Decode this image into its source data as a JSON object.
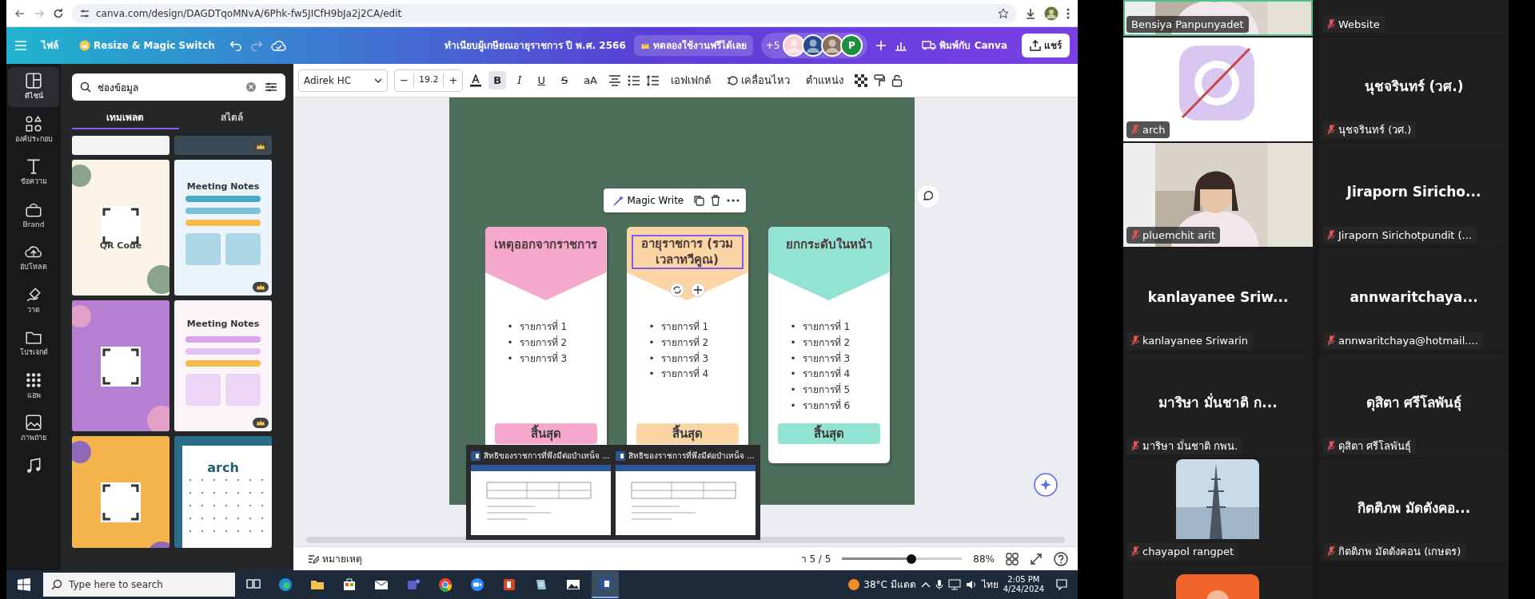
{
  "browser": {
    "url": "canva.com/design/DAGDTqoMNvA/6Phk-fw5JICfH9bJa2j2CA/edit"
  },
  "canva_header": {
    "file_menu": "ไฟล์",
    "resize_button": "Resize & Magic Switch",
    "document_title": "ทำเนียบผู้เกษียณอายุราชการ ปี พ.ศ. 2566",
    "trial_button": "ทดลองใช้งานฟรีได้เลย",
    "collaborators_more": "+5",
    "collaborator_initial": "P",
    "print_button": "พิมพ์กับ Canva",
    "share_button": "แชร์"
  },
  "text_toolbar": {
    "font": "Adirek HC",
    "decrease": "−",
    "font_size": "19.2",
    "increase": "+",
    "format_buttons": [
      {
        "kind": "bold",
        "label": "B",
        "selected": true
      },
      {
        "kind": "italic",
        "label": "I",
        "selected": false
      },
      {
        "kind": "underline",
        "label": "U",
        "selected": false
      },
      {
        "kind": "strike",
        "label": "S",
        "selected": false
      },
      {
        "kind": "case",
        "label": "aA",
        "selected": false
      }
    ],
    "effects": "เอฟเฟกต์",
    "animate": "เคลื่อนไหว",
    "position": "ตำแหน่ง"
  },
  "sidebar": {
    "items": [
      {
        "kind": "design",
        "label": "ดีไซน์",
        "selected": true
      },
      {
        "kind": "elements",
        "label": "องค์ประกอบ",
        "selected": false
      },
      {
        "kind": "text",
        "label": "ข้อความ",
        "selected": false
      },
      {
        "kind": "brand",
        "label": "Brand",
        "selected": false
      },
      {
        "kind": "uploads",
        "label": "อัปโหลด",
        "selected": false
      },
      {
        "kind": "draw",
        "label": "วาด",
        "selected": false
      },
      {
        "kind": "projects",
        "label": "โปรเจกต์",
        "selected": false
      },
      {
        "kind": "apps",
        "label": "แอพ",
        "selected": false
      },
      {
        "kind": "photos",
        "label": "ภาพถ่าย",
        "selected": false
      },
      {
        "kind": "audio",
        "selected": false
      }
    ]
  },
  "panel": {
    "search": {
      "value": "ช่องข้อมูล"
    },
    "tabs": [
      {
        "label": "เทมเพลต",
        "selected": true
      },
      {
        "label": "สไตล์",
        "selected": false
      }
    ],
    "templates": [
      {
        "kind": "partial-light",
        "premium": false
      },
      {
        "kind": "partial-dark",
        "premium": true
      },
      {
        "kind": "qr-cream",
        "title": "QR Code",
        "premium": false
      },
      {
        "kind": "notes-blue",
        "title": "Meeting Notes",
        "premium": true
      },
      {
        "kind": "qr-purple",
        "premium": false
      },
      {
        "kind": "notes-pink",
        "title": "Meeting Notes",
        "premium": true
      },
      {
        "kind": "qr-orange",
        "premium": false
      },
      {
        "kind": "calendar",
        "title": "arch",
        "premium": false
      }
    ]
  },
  "design": {
    "magic_write": "Magic Write",
    "cards": [
      {
        "heading": "เหตุออกจากราชการ",
        "color": "#f5a8cc",
        "selected": false,
        "bullet": "•",
        "items": [
          "รายการที่ 1",
          "รายการที่ 2",
          "รายการที่ 3"
        ],
        "footer": "สิ้นสุด"
      },
      {
        "heading": "อายุราชการ (รวมเวลาทวีคูณ)",
        "color": "#fbd5a5",
        "selected": true,
        "bullet": "•",
        "items": [
          "รายการที่ 1",
          "รายการที่ 2",
          "รายการที่ 3",
          "รายการที่ 4"
        ],
        "footer": "สิ้นสุด"
      },
      {
        "heading": "ยกกระดับในหน้า",
        "color": "#93e3d2",
        "selected": false,
        "bullet": "•",
        "items": [
          "รายการที่ 1",
          "รายการที่ 2",
          "รายการที่ 3",
          "รายการที่ 4",
          "รายการที่ 5",
          "รายการที่ 6"
        ],
        "footer": "สิ้นสุด"
      }
    ]
  },
  "taskbar_previews": [
    {
      "title": "สิทธิของราชการที่พึงมีต่อบำเหน็จ ..."
    },
    {
      "title": "สิทธิของราชการที่พึงมีต่อบำเหน็จ ..."
    }
  ],
  "status_bar": {
    "notes": "หมายเหตุ",
    "page": "า 5 / 5",
    "zoom": {
      "level": 0.58
    },
    "zoom_reading": "88%"
  },
  "taskbar": {
    "search_placeholder": "Type here to search",
    "apps": [
      {
        "kind": "taskview",
        "active": false
      },
      {
        "kind": "edge",
        "active": false
      },
      {
        "kind": "folder",
        "active": false
      },
      {
        "kind": "store",
        "active": false
      },
      {
        "kind": "mail",
        "active": false
      },
      {
        "kind": "teams",
        "active": false
      },
      {
        "kind": "chrome",
        "active": false
      },
      {
        "kind": "zoom",
        "active": false
      },
      {
        "kind": "powerpoint",
        "active": false
      },
      {
        "kind": "notes",
        "active": false
      },
      {
        "kind": "photos",
        "active": false
      },
      {
        "kind": "word",
        "active": true
      }
    ],
    "weather": "38°C มีแดด",
    "language": "ไทย",
    "time": "2:05 PM",
    "date": "4/24/2024"
  },
  "meeting": {
    "tiles": [
      {
        "kind": "video",
        "label": "Bensiya Panpunyadet",
        "muted": false,
        "speaking": true
      },
      {
        "kind": "name",
        "label": "Website",
        "muted": true,
        "speaking": false
      },
      {
        "kind": "app-avatar",
        "label": "arch",
        "muted": true,
        "speaking": false
      },
      {
        "kind": "name",
        "name": "นุชจรินทร์ (วศ.)",
        "label": "นุชจรินทร์ (วศ.)",
        "muted": true,
        "speaking": false
      },
      {
        "kind": "video",
        "label": "pluemchit arit",
        "muted": true,
        "speaking": false
      },
      {
        "kind": "name",
        "name": "Jiraporn  Siricho...",
        "label": "Jiraporn Sirichotpundit (...",
        "muted": true,
        "speaking": false
      },
      {
        "kind": "name",
        "name": "kanlayanee  Sriw...",
        "label": "kanlayanee Sriwarin",
        "muted": true,
        "speaking": false
      },
      {
        "kind": "name",
        "name": "annwaritchaya...",
        "label": "annwaritchaya@hotmail....",
        "muted": true,
        "speaking": false
      },
      {
        "kind": "name",
        "name": "มาริษา มั่นชาติ ก...",
        "label": "มาริษา มั่นชาติ กพน.",
        "muted": true,
        "speaking": false
      },
      {
        "kind": "name",
        "name": "ดุสิตา  ศรีโลพันธุ์",
        "label": "ดุสิตา  ศรีโลพันธุ์",
        "muted": true,
        "speaking": false
      },
      {
        "kind": "photo-avatar",
        "label": "chayapol rangpet",
        "muted": true,
        "speaking": false
      },
      {
        "kind": "name",
        "name": "กิตติภพ มัดตังคอ...",
        "label": "กิตติภพ มัดตังคอน (เกษตร)",
        "muted": true,
        "speaking": false
      },
      {
        "kind": "color-avatar",
        "speaking": false
      }
    ]
  }
}
